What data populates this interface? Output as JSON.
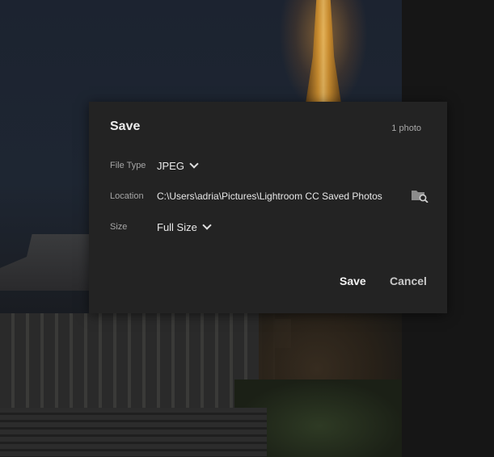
{
  "dialog": {
    "title": "Save",
    "photo_count": "1 photo",
    "file_type": {
      "label": "File Type",
      "value": "JPEG"
    },
    "location": {
      "label": "Location",
      "path": "C:\\Users\\adria\\Pictures\\Lightroom CC Saved Photos",
      "browse_icon": "folder-search-icon"
    },
    "size": {
      "label": "Size",
      "value": "Full Size"
    },
    "buttons": {
      "save": "Save",
      "cancel": "Cancel"
    }
  },
  "colors": {
    "dialog_bg": "#232323",
    "label_text": "#a5a5a5",
    "value_text": "#e8e8e8"
  }
}
